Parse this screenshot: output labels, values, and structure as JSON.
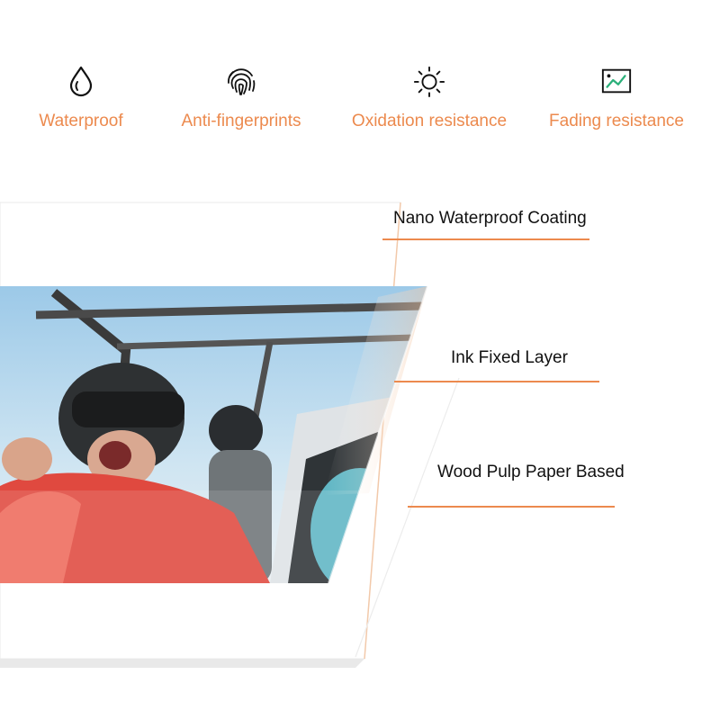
{
  "features": [
    {
      "label": "Waterproof",
      "icon": "water-drop-icon"
    },
    {
      "label": "Anti-fingerprints",
      "icon": "fingerprint-icon"
    },
    {
      "label": "Oxidation resistance",
      "icon": "sun-icon"
    },
    {
      "label": "Fading resistance",
      "icon": "image-trend-icon"
    }
  ],
  "layers": [
    {
      "label": "Nano Waterproof  Coating"
    },
    {
      "label": "Ink Fixed Layer"
    },
    {
      "label": "Wood Pulp Paper Based"
    }
  ],
  "colors": {
    "accent": "#ec8a4e",
    "text": "#111111"
  }
}
